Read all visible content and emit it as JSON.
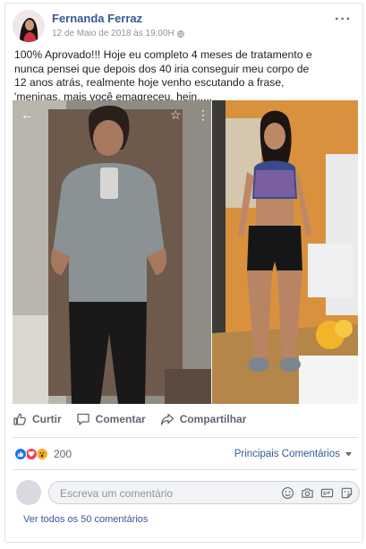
{
  "post": {
    "author": "Fernanda Ferraz",
    "timestamp": "12 de Maio de 2018 às 19:00H",
    "privacy_icon": "globe-icon",
    "more_icon": "···",
    "text_lines": [
      "100% Aprovado!!! Hoje eu completo 4 meses de tratamento e",
      "nunca pensei que depois dos 40 iria conseguir meu corpo de",
      "12 anos atrás, realmente hoje venho escutando a frase,",
      "'meninas, mais você emagreceu, hein....."
    ]
  },
  "photo": {
    "back_icon": "←",
    "star_icon": "☆",
    "menu_icon": "⋮"
  },
  "actions": {
    "like": "Curtir",
    "comment": "Comentar",
    "share": "Compartilhar"
  },
  "reactions": {
    "icons": [
      "like-reaction",
      "love-reaction",
      "wow-reaction"
    ],
    "colors": {
      "like": "#1877f2",
      "love": "#f33e58",
      "wow": "#f7b125"
    },
    "count": "200",
    "top_comments": "Principais Comentários"
  },
  "comment_box": {
    "placeholder": "Escreva um comentário"
  },
  "view_all_comments": "Ver todos os 50 comentários"
}
